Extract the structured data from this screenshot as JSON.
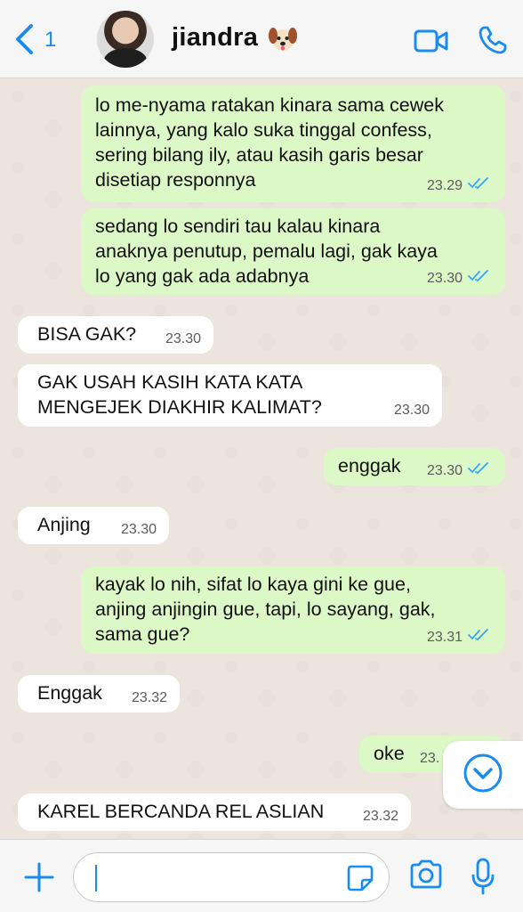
{
  "header": {
    "back_count": "1",
    "contact_name": "jiandra",
    "icons": {
      "back": "chevron-left-icon",
      "video": "video-call-icon",
      "call": "phone-icon",
      "emoji": "dog-face-emoji"
    },
    "accent_color": "#1a8cf0"
  },
  "messages": [
    {
      "dir": "out",
      "text": "lo me-nyama ratakan kinara sama cewek\nlainnya, yang kalo suka tinggal confess,\nsering bilang ily, atau kasih garis besar\ndisetiap responnya",
      "time": "23.29",
      "read": true
    },
    {
      "dir": "out",
      "text": "sedang lo sendiri tau kalau kinara\nanaknya penutup, pemalu lagi, gak kaya\nlo yang gak ada adabnya",
      "time": "23.30",
      "read": true
    },
    {
      "dir": "in",
      "text": "BISA GAK?",
      "time": "23.30"
    },
    {
      "dir": "in",
      "text": "GAK USAH KASIH KATA KATA\nMENGEJEK DIAKHIR KALIMAT?",
      "time": "23.30"
    },
    {
      "dir": "out",
      "text": "enggak",
      "time": "23.30",
      "read": true
    },
    {
      "dir": "in",
      "text": "Anjing",
      "time": "23.30"
    },
    {
      "dir": "out",
      "text": "kayak lo nih, sifat lo kaya gini ke gue,\nanjing anjingin gue, tapi, lo sayang, gak,\nsama gue?",
      "time": "23.31",
      "read": true
    },
    {
      "dir": "in",
      "text": "Enggak",
      "time": "23.32"
    },
    {
      "dir": "out",
      "text": "oke",
      "time": "23.",
      "read": false
    },
    {
      "dir": "in",
      "text": "KAREL BERCANDA REL ASLIAN",
      "time": "23.32"
    }
  ],
  "colors": {
    "outgoing_bubble": "#dcf8c6",
    "incoming_bubble": "#ffffff",
    "chat_background": "#ece5dd",
    "read_ticks": "#34a5f5"
  },
  "composer": {
    "icons": {
      "add": "plus-icon",
      "sticker": "sticker-icon",
      "camera": "camera-icon",
      "mic": "microphone-icon",
      "scroll_down": "chevron-down-circle-icon"
    }
  }
}
